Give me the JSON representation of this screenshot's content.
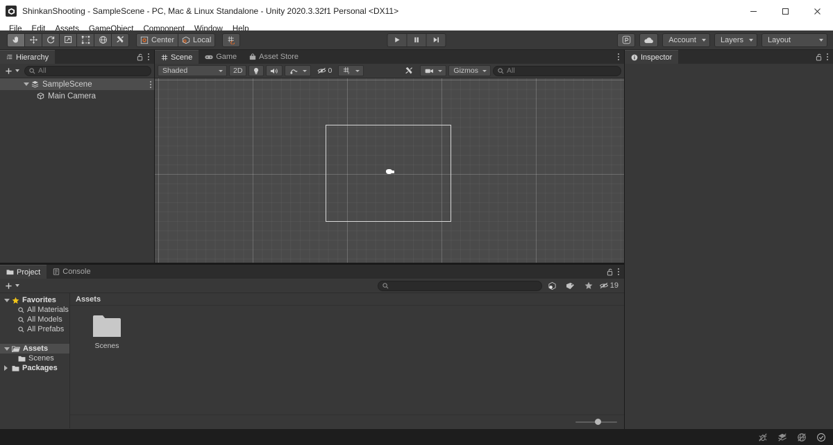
{
  "window": {
    "title": "ShinkanShooting - SampleScene - PC, Mac & Linux Standalone - Unity 2020.3.32f1 Personal <DX11>",
    "app_icon": "unity-icon",
    "minimize": "minimize-icon",
    "maximize": "maximize-icon",
    "close": "close-icon"
  },
  "menubar": {
    "items": [
      {
        "label": "File"
      },
      {
        "label": "Edit"
      },
      {
        "label": "Assets"
      },
      {
        "label": "GameObject"
      },
      {
        "label": "Component"
      },
      {
        "label": "Window"
      },
      {
        "label": "Help"
      }
    ]
  },
  "toolbar": {
    "tools": [
      {
        "name": "hand-tool",
        "icon": "hand-icon",
        "active": true
      },
      {
        "name": "move-tool",
        "icon": "move-icon",
        "active": false
      },
      {
        "name": "rotate-tool",
        "icon": "rotate-icon",
        "active": false
      },
      {
        "name": "scale-tool",
        "icon": "scale-icon",
        "active": false
      },
      {
        "name": "rect-tool",
        "icon": "rect-icon",
        "active": false
      },
      {
        "name": "transform-tool",
        "icon": "transform-icon",
        "active": false
      },
      {
        "name": "custom-tool",
        "icon": "wrench-icon",
        "active": false
      }
    ],
    "pivot_label": "Center",
    "pivot_icon": "pivot-center-icon",
    "rotation_label": "Local",
    "rotation_icon": "handle-local-icon",
    "snap_icon": "grid-snap-icon",
    "play": "play-icon",
    "pause": "pause-icon",
    "step": "step-icon",
    "collab_icon": "collab-icon",
    "cloud_icon": "cloud-icon",
    "account_label": "Account",
    "layers_label": "Layers",
    "layout_label": "Layout"
  },
  "hierarchy": {
    "tab_label": "Hierarchy",
    "tab_icon": "hierarchy-icon",
    "lock_icon": "lock-open-icon",
    "menu_icon": "kebab-icon",
    "create_label": "+",
    "search_placeholder": "All",
    "search_value": "",
    "rows": [
      {
        "label": "SampleScene",
        "icon": "scene-icon",
        "depth": 1,
        "selected": true,
        "expanded": true,
        "has_menu": true
      },
      {
        "label": "Main Camera",
        "icon": "gameobject-icon",
        "depth": 2,
        "selected": false,
        "expanded": false,
        "has_menu": false
      }
    ]
  },
  "scene": {
    "tabs": [
      {
        "label": "Scene",
        "icon": "scene-tab-icon",
        "active": true
      },
      {
        "label": "Game",
        "icon": "game-tab-icon",
        "active": false
      },
      {
        "label": "Asset Store",
        "icon": "store-tab-icon",
        "active": false
      }
    ],
    "menu_icon": "kebab-icon",
    "shading_mode": "Shaded",
    "mode_2d": "2D",
    "lighting_icon": "light-icon",
    "audio_icon": "audio-icon",
    "fx_icon": "fx-icon",
    "hidden_count": "0",
    "hidden_icon": "eye-off-icon",
    "grid_icon": "grid-axis-icon",
    "tools_icon": "scene-tools-icon",
    "camera_icon": "scene-camera-icon",
    "gizmos_label": "Gizmos",
    "search_placeholder": "All",
    "search_value": "",
    "viewport": {
      "camera_gizmo": "camera-gizmo",
      "frustum": "camera-frustum"
    }
  },
  "inspector": {
    "tab_label": "Inspector",
    "tab_icon": "info-icon",
    "lock_icon": "lock-open-icon",
    "menu_icon": "kebab-icon"
  },
  "project": {
    "tabs": [
      {
        "label": "Project",
        "icon": "project-icon",
        "active": true
      },
      {
        "label": "Console",
        "icon": "console-icon",
        "active": false
      }
    ],
    "lock_icon": "lock-open-icon",
    "menu_icon": "kebab-icon",
    "create_label": "+",
    "search_placeholder": "",
    "search_value": "",
    "filter_type_icon": "filter-type-icon",
    "filter_label_icon": "filter-label-icon",
    "favorite_icon": "star-icon",
    "hidden_packages_count": "19",
    "hidden_packages_icon": "eye-off-icon",
    "tree": [
      {
        "label": "Favorites",
        "icon": "star-icon",
        "depth": 0,
        "expanded": true,
        "bold": true,
        "selected": false
      },
      {
        "label": "All Materials",
        "icon": "search-small-icon",
        "depth": 1,
        "expanded": null,
        "bold": false,
        "selected": false
      },
      {
        "label": "All Models",
        "icon": "search-small-icon",
        "depth": 1,
        "expanded": null,
        "bold": false,
        "selected": false
      },
      {
        "label": "All Prefabs",
        "icon": "search-small-icon",
        "depth": 1,
        "expanded": null,
        "bold": false,
        "selected": false
      },
      {
        "label": "Assets",
        "icon": "folder-open-icon",
        "depth": 0,
        "expanded": true,
        "bold": true,
        "selected": true
      },
      {
        "label": "Scenes",
        "icon": "folder-icon",
        "depth": 1,
        "expanded": null,
        "bold": false,
        "selected": false
      },
      {
        "label": "Packages",
        "icon": "folder-icon",
        "depth": 0,
        "expanded": false,
        "bold": true,
        "selected": false
      }
    ],
    "breadcrumb": "Assets",
    "assets": [
      {
        "label": "Scenes",
        "icon": "folder-icon"
      }
    ],
    "zoom_slider": "asset-size-slider"
  },
  "statusbar": {
    "icons": [
      {
        "name": "bug-muted-icon"
      },
      {
        "name": "layers-muted-icon"
      },
      {
        "name": "globe-muted-icon"
      },
      {
        "name": "check-circle-icon"
      }
    ]
  },
  "colors": {
    "panel_bg": "#383838",
    "tab_bg": "#2c2c2c",
    "toolbar_bg": "#393939",
    "selection": "#4d4d4d",
    "viewport_bg": "#4a4a4a",
    "titlebar_bg": "#ffffff",
    "statusbar_bg": "#1d1d1d",
    "star_yellow": "#f0c419",
    "accent_orange": "#e06c2a"
  }
}
